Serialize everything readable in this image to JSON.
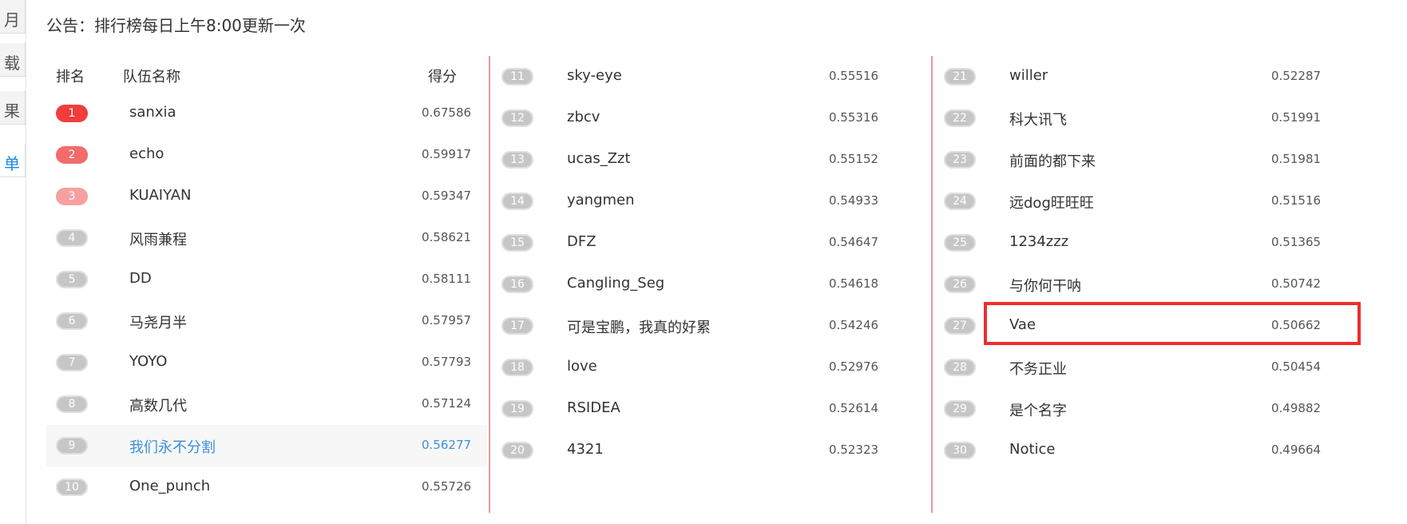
{
  "sidebar": {
    "items": [
      "月",
      "载",
      "果",
      "单"
    ]
  },
  "notice": "公告：排行榜每日上午8:00更新一次",
  "headers": {
    "rank": "排名",
    "team": "队伍名称",
    "score": "得分"
  },
  "rows": [
    {
      "rank": "1",
      "name": "sanxia",
      "score": "0.67586"
    },
    {
      "rank": "2",
      "name": "echo",
      "score": "0.59917"
    },
    {
      "rank": "3",
      "name": "KUAIYAN",
      "score": "0.59347"
    },
    {
      "rank": "4",
      "name": "风雨兼程",
      "score": "0.58621"
    },
    {
      "rank": "5",
      "name": "DD",
      "score": "0.58111"
    },
    {
      "rank": "6",
      "name": "马尧月半",
      "score": "0.57957"
    },
    {
      "rank": "7",
      "name": "YOYO",
      "score": "0.57793"
    },
    {
      "rank": "8",
      "name": "高数几代",
      "score": "0.57124"
    },
    {
      "rank": "9",
      "name": "我们永不分割",
      "score": "0.56277"
    },
    {
      "rank": "10",
      "name": "One_punch",
      "score": "0.55726"
    },
    {
      "rank": "11",
      "name": "sky-eye",
      "score": "0.55516"
    },
    {
      "rank": "12",
      "name": "zbcv",
      "score": "0.55316"
    },
    {
      "rank": "13",
      "name": "ucas_Zzt",
      "score": "0.55152"
    },
    {
      "rank": "14",
      "name": "yangmen",
      "score": "0.54933"
    },
    {
      "rank": "15",
      "name": "DFZ",
      "score": "0.54647"
    },
    {
      "rank": "16",
      "name": "Cangling_Seg",
      "score": "0.54618"
    },
    {
      "rank": "17",
      "name": "可是宝鹏，我真的好累",
      "score": "0.54246"
    },
    {
      "rank": "18",
      "name": "love",
      "score": "0.52976"
    },
    {
      "rank": "19",
      "name": "RSIDEA",
      "score": "0.52614"
    },
    {
      "rank": "20",
      "name": "4321",
      "score": "0.52323"
    },
    {
      "rank": "21",
      "name": "willer",
      "score": "0.52287"
    },
    {
      "rank": "22",
      "name": "科大讯飞",
      "score": "0.51991"
    },
    {
      "rank": "23",
      "name": "前面的都下来",
      "score": "0.51981"
    },
    {
      "rank": "24",
      "name": "远dog旺旺旺",
      "score": "0.51516"
    },
    {
      "rank": "25",
      "name": "1234zzz",
      "score": "0.51365"
    },
    {
      "rank": "26",
      "name": "与你何干呐",
      "score": "0.50742"
    },
    {
      "rank": "27",
      "name": "Vae",
      "score": "0.50662"
    },
    {
      "rank": "28",
      "name": "不务正业",
      "score": "0.50454"
    },
    {
      "rank": "29",
      "name": "是个名字",
      "score": "0.49882"
    },
    {
      "rank": "30",
      "name": "Notice",
      "score": "0.49664"
    }
  ],
  "colors": {
    "accent": "#3b8ede",
    "highlight_box": "#ef2d2d",
    "divider": "#e89a9a"
  }
}
